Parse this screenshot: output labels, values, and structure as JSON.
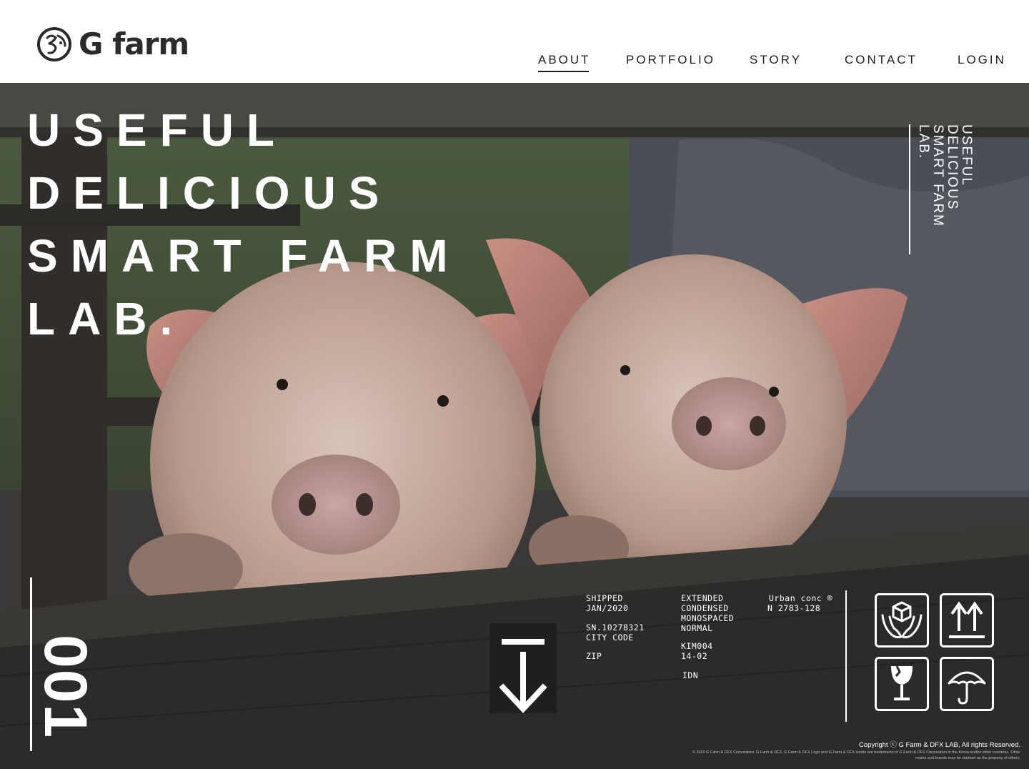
{
  "brand": {
    "name": "G farm"
  },
  "nav": {
    "items": [
      {
        "label": "ABOUT",
        "active": true
      },
      {
        "label": "PORTFOLIO",
        "active": false
      },
      {
        "label": "STORY",
        "active": false
      },
      {
        "label": "CONTACT",
        "active": false
      },
      {
        "label": "LOGIN",
        "active": false
      }
    ]
  },
  "hero": {
    "headline": [
      "USEFUL",
      "DELICIOUS",
      "SMART FARM",
      "LAB."
    ],
    "side_text": [
      "USEFUL",
      "DELICIOUS",
      "SMART FARM",
      "LAB."
    ],
    "page_number": "001"
  },
  "info": {
    "shipped": "SHIPPED\nJAN/2020",
    "serial": "SN.10278321\nCITY CODE",
    "zip": "ZIP",
    "typeface": "EXTENDED\nCONDENSED\nMONOSPACED\nNORMAL",
    "code": "KIM004\n14-02",
    "country": "IDN",
    "urban": "Urban conc ®",
    "urban_num": "N  2783-128"
  },
  "icons": [
    "handle-with-care-icon",
    "this-way-up-icon",
    "fragile-icon",
    "keep-dry-icon"
  ],
  "footer": {
    "copyright": "Copyright ⓒ G Farm & DFX LAB, All rights Reserved.",
    "legal": "© 2020 G Farm & DFX Corporation. G Farm & DFX, G Farm & DFX Logo and G Farm & DFX words are trademarks of G Farm & DFX Corporation in the Korea and/or other countries. Other marks and brands may be claimed as the property of others."
  },
  "colors": {
    "header_bg": "#ffffff",
    "text_dark": "#1e1e1e",
    "hero_overlay": "#3a3836",
    "hero_text": "#ffffff"
  }
}
